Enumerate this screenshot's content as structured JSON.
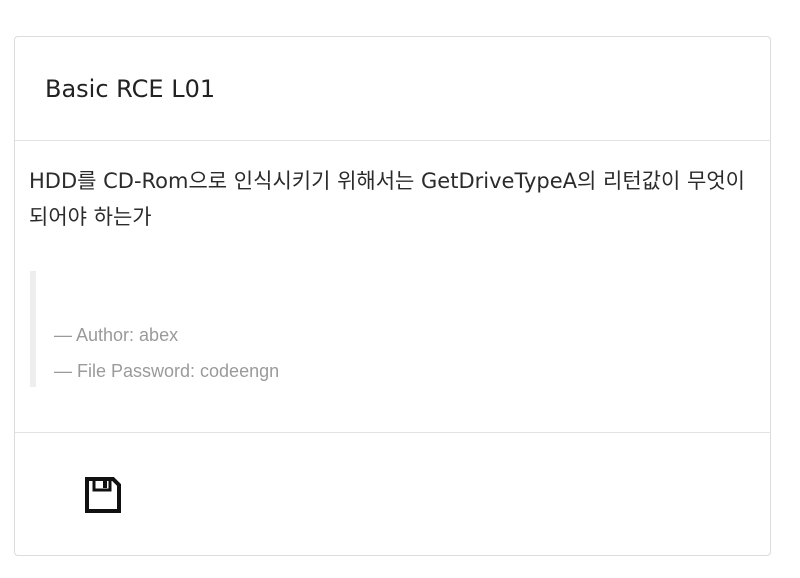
{
  "card": {
    "title": "Basic RCE L01",
    "question": "HDD를 CD-Rom으로 인식시키기 위해서는 GetDriveTypeA의 리턴값이 무엇이 되어야 하는가",
    "quote": {
      "author": "— Author: abex",
      "password": "— File Password: codeengn"
    },
    "footer": {
      "icon": "floppy-disk-icon"
    }
  }
}
